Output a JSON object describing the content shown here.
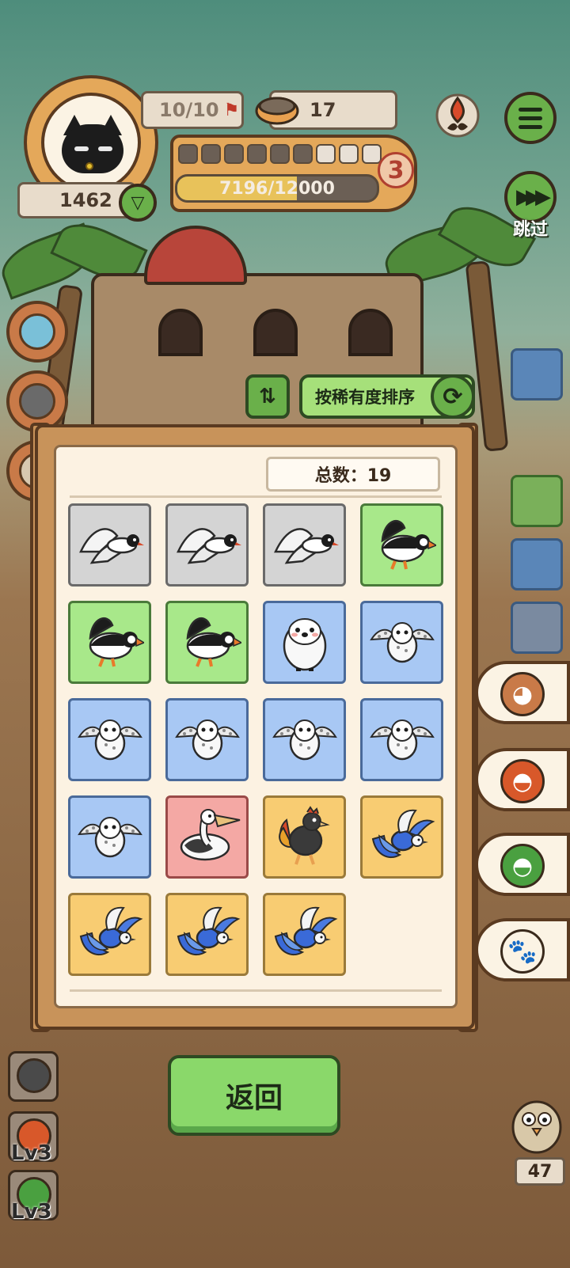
{
  "hud": {
    "progress_count": "10/10",
    "coins": "17",
    "currency": "1462",
    "xp_text": "7196/12000",
    "xp_fraction": 0.5997,
    "segments_total": 9,
    "segments_filled": 6,
    "level": "3",
    "skip_label": "跳过"
  },
  "sort": {
    "label": "按稀有度排序"
  },
  "panel": {
    "total_label": "总数：19"
  },
  "cards": [
    {
      "rarity": "gray",
      "bird": "tern-icon"
    },
    {
      "rarity": "gray",
      "bird": "tern-icon"
    },
    {
      "rarity": "gray",
      "bird": "tern-icon"
    },
    {
      "rarity": "green",
      "bird": "puffin-icon"
    },
    {
      "rarity": "green",
      "bird": "puffin-icon"
    },
    {
      "rarity": "green",
      "bird": "puffin-icon"
    },
    {
      "rarity": "blue",
      "bird": "penguin-chick-icon"
    },
    {
      "rarity": "blue",
      "bird": "snowy-owl-icon"
    },
    {
      "rarity": "blue",
      "bird": "snowy-owl-icon"
    },
    {
      "rarity": "blue",
      "bird": "snowy-owl-icon"
    },
    {
      "rarity": "blue",
      "bird": "snowy-owl-icon"
    },
    {
      "rarity": "blue",
      "bird": "snowy-owl-icon"
    },
    {
      "rarity": "blue",
      "bird": "snowy-owl-icon"
    },
    {
      "rarity": "pink",
      "bird": "pelican-icon"
    },
    {
      "rarity": "gold",
      "bird": "rooster-icon"
    },
    {
      "rarity": "gold",
      "bird": "blue-phoenix-icon"
    },
    {
      "rarity": "gold",
      "bird": "blue-phoenix-icon"
    },
    {
      "rarity": "gold",
      "bird": "blue-phoenix-icon"
    },
    {
      "rarity": "gold",
      "bird": "blue-phoenix-icon"
    }
  ],
  "colors": {
    "gray": "#d4d4d4",
    "green": "#a8e88a",
    "blue": "#a8c8f4",
    "pink": "#f4a8a4",
    "gold": "#f8cc72"
  },
  "footer": {
    "back_label": "返回",
    "slot_level_1": "Lv3",
    "slot_level_2": "Lv3",
    "pet_count": "47"
  }
}
